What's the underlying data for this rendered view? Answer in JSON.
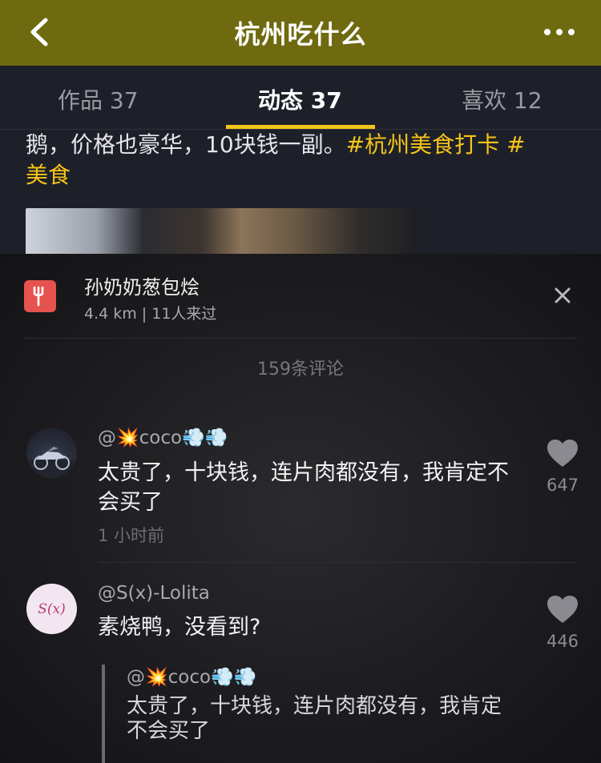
{
  "header": {
    "title": "杭州吃什么"
  },
  "tabs": [
    {
      "label": "作品 37",
      "active": false
    },
    {
      "label": "动态 37",
      "active": true
    },
    {
      "label": "喜欢 12",
      "active": false
    }
  ],
  "post": {
    "text": "鹅，价格也豪华，10块钱一副。",
    "tag1": "#杭州美食打卡 #",
    "tag2": "美食"
  },
  "poi": {
    "name": "孙奶奶葱包烩",
    "meta": "4.4 km | 11人来过"
  },
  "comments_count": "159条评论",
  "comments": [
    {
      "username": "@💥coco💨💨",
      "text": "太贵了，十块钱，连片肉都没有，我肯定不会买了",
      "time": "1 小时前",
      "likes": "647"
    },
    {
      "username": "@S(x)-Lolita",
      "avatar_text": "S(x)",
      "text": "素烧鸭，没看到?",
      "likes": "446",
      "quote": {
        "username": "@💥coco💨💨",
        "text": "太贵了，十块钱，连片肉都没有，我肯定不会买了"
      }
    }
  ],
  "colors": {
    "header_bg": "#6f6a10",
    "accent": "#f5c518",
    "poi_icon": "#e6534f"
  },
  "icons": {
    "back": "chevron-left-icon",
    "more": "more-dots-icon",
    "poi": "fork-icon",
    "close": "close-icon",
    "like": "heart-icon"
  }
}
